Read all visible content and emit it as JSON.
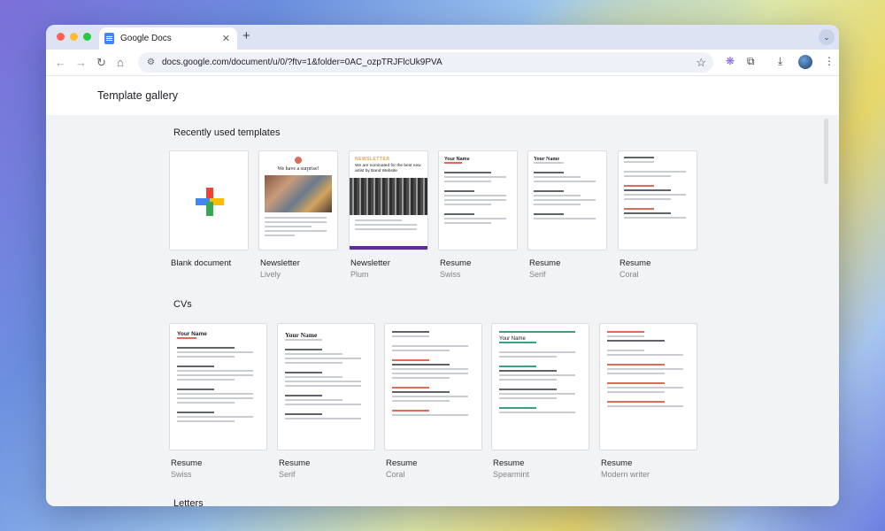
{
  "browser": {
    "tab_title": "Google Docs",
    "tab_close": "✕",
    "new_tab": "+",
    "tab_menu": "⌄",
    "url": "docs.google.com/document/u/0/?ftv=1&folder=0AC_ozpTRJFlcUk9PVA",
    "back": "←",
    "forward": "→",
    "reload": "↻",
    "home": "⌂",
    "site_info": "⚙",
    "star": "☆",
    "extension": "❋",
    "puzzle": "⧉",
    "download": "⤓",
    "menu": "⋮"
  },
  "gallery": {
    "title": "Template gallery",
    "sections": [
      {
        "title": "Recently used templates",
        "cards": [
          {
            "name": "Blank document",
            "sub": ""
          },
          {
            "name": "Newsletter",
            "sub": "Lively",
            "thumb_heading": "We have a surprise!"
          },
          {
            "name": "Newsletter",
            "sub": "Plum",
            "thumb_heading": "NEWSLETTER",
            "thumb_text": "We are nominated for the best new artist by Band Website"
          },
          {
            "name": "Resume",
            "sub": "Swiss",
            "thumb_heading": "Your Name"
          },
          {
            "name": "Resume",
            "sub": "Serif",
            "thumb_heading": "Your Name"
          },
          {
            "name": "Resume",
            "sub": "Coral",
            "thumb_heading": ""
          }
        ]
      },
      {
        "title": "CVs",
        "cards": [
          {
            "name": "Resume",
            "sub": "Swiss",
            "thumb_heading": "Your Name"
          },
          {
            "name": "Resume",
            "sub": "Serif",
            "thumb_heading": "Your Name"
          },
          {
            "name": "Resume",
            "sub": "Coral",
            "thumb_heading": ""
          },
          {
            "name": "Resume",
            "sub": "Spearmint",
            "thumb_heading": "Your Name"
          },
          {
            "name": "Resume",
            "sub": "Modern writer",
            "thumb_heading": ""
          }
        ]
      },
      {
        "title": "Letters"
      }
    ]
  },
  "colors": {
    "google_red": "#ea4335",
    "google_blue": "#4285f4",
    "google_yellow": "#fbbc04",
    "google_green": "#34a853",
    "plum": "#5b2f98"
  }
}
